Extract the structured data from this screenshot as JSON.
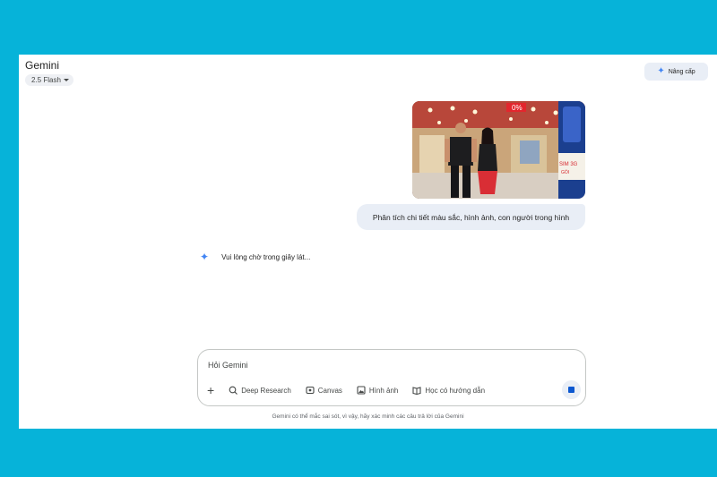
{
  "app": {
    "title": "Gemini",
    "model": "2.5 Flash"
  },
  "header": {
    "upgrade_label": "Nâng cấp"
  },
  "chat": {
    "user_message": "Phân tích chi tiết màu sắc, hình ảnh, con người trong hình",
    "status": "Vui lòng chờ trong giây lát..."
  },
  "input": {
    "placeholder": "Hỏi Gemini"
  },
  "tools": {
    "deep_research": "Deep Research",
    "canvas": "Canvas",
    "image": "Hình ảnh",
    "guided": "Học có hướng dẫn"
  },
  "footer": {
    "disclaimer": "Gemini có thể mắc sai sót, vì vậy, hãy xác minh các câu trả lời của Gemini"
  },
  "photo": {
    "badge": "0%",
    "side_text": "SIM 3G",
    "side_text_2": "GÓI"
  },
  "colors": {
    "background": "#06b3d9",
    "accent": "#0b57d0",
    "bubble": "#e9eef6"
  }
}
